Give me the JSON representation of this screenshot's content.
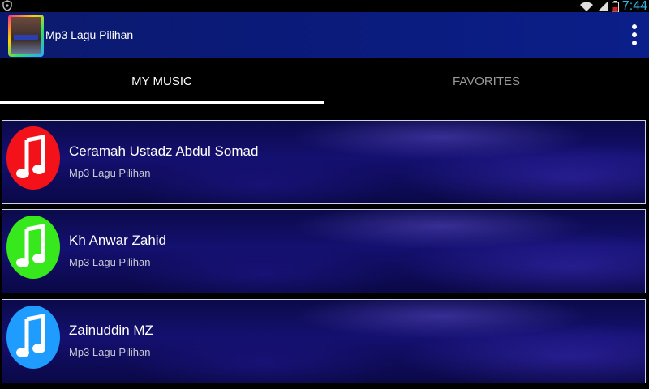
{
  "status_bar": {
    "time": "7:44",
    "icons": [
      "shield-icon",
      "wifi-icon",
      "signal-icon",
      "battery-icon"
    ]
  },
  "action_bar": {
    "title": "Mp3 Lagu Pilihan",
    "overflow_icon": "more-vert-icon"
  },
  "tabs": [
    {
      "label": "MY MUSIC",
      "active": true
    },
    {
      "label": "FAVORITES",
      "active": false
    }
  ],
  "list": {
    "items": [
      {
        "title": "Ceramah Ustadz Abdul Somad",
        "subtitle": "Mp3 Lagu Pilihan",
        "icon": "music-note-icon",
        "color": "#f3121a"
      },
      {
        "title": "Kh Anwar Zahid",
        "subtitle": "Mp3 Lagu Pilihan",
        "icon": "music-note-icon",
        "color": "#37e81c"
      },
      {
        "title": "Zainuddin MZ",
        "subtitle": "Mp3 Lagu Pilihan",
        "icon": "music-note-icon",
        "color": "#1f9cff"
      }
    ]
  }
}
